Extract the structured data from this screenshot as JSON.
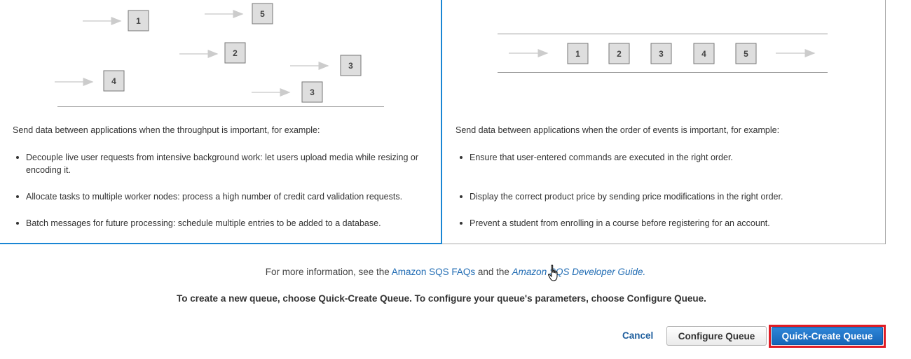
{
  "standard_panel": {
    "diagram_boxes": [
      "1",
      "5",
      "2",
      "3",
      "4",
      "3"
    ],
    "intro": "Send data between applications when the throughput is important, for example:",
    "bullets": [
      "Decouple live user requests from intensive background work: let users upload media while resizing or encoding it.",
      "Allocate tasks to multiple worker nodes: process a high number of credit card validation requests.",
      "Batch messages for future processing: schedule multiple entries to be added to a database."
    ]
  },
  "fifo_panel": {
    "diagram_boxes": [
      "1",
      "2",
      "3",
      "4",
      "5"
    ],
    "intro": "Send data between applications when the order of events is important, for example:",
    "bullets": [
      "Ensure that user-entered commands are executed in the right order.",
      "Display the correct product price by sending price modifications in the right order.",
      "Prevent a student from enrolling in a course before registering for an account."
    ]
  },
  "info": {
    "prefix": "For more information, see the",
    "faq_link": "Amazon SQS FAQs",
    "middle": "and the",
    "guide_link": "Amazon SQS Developer Guide."
  },
  "instruction": "To create a new queue, choose Quick-Create Queue. To configure your queue's parameters, choose Configure Queue.",
  "actions": {
    "cancel": "Cancel",
    "configure": "Configure Queue",
    "quick_create": "Quick-Create Queue"
  },
  "colors": {
    "accent_blue": "#1a86d4",
    "primary_button": "#1f74c8",
    "highlight_red": "#e01c24",
    "link": "#1f6bb3"
  }
}
